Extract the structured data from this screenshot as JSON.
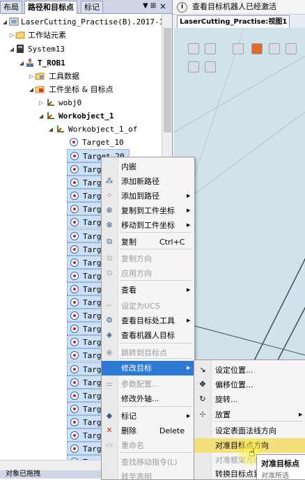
{
  "left_tabs": [
    "布局",
    "路径和目标点",
    "标记"
  ],
  "tab_pin": "▼ ⊞",
  "tab_close": "×",
  "bottom_tab": "对象已拖拽",
  "tree": {
    "station": "LaserCutting_Practise(B).2017-1-◦",
    "station_elements": "工作站元素",
    "system": "System13",
    "robot": "T_ROB1",
    "tool_data": "工具数据",
    "workobjects_targets": "工件坐标 & 目标点",
    "wobj0": "wobj0",
    "workobject1": "Workobject_1",
    "workobject1_of": "Workobject_1_of",
    "target10": "Target_10",
    "target20": "Target_20",
    "target_truncated": "Targ"
  },
  "info_bar": "查看目标机器人已经激活",
  "view_tab": "LaserCutting_Practise:视图1",
  "context_menu": {
    "items": [
      {
        "label": "内嵌",
        "icon": "",
        "disabled": false
      },
      {
        "label": "添加新路径",
        "icon": "new-path-icon",
        "disabled": false
      },
      {
        "label": "添加到路径",
        "icon": "add-to-path-icon",
        "disabled": false,
        "arrow": true
      },
      {
        "label": "复制到工件坐标",
        "icon": "copy-to-wobj-icon",
        "disabled": false,
        "arrow": true
      },
      {
        "label": "移动到工件坐标",
        "icon": "move-to-wobj-icon",
        "disabled": false,
        "arrow": true
      },
      {
        "label": "复制",
        "shortcut": "Ctrl+C",
        "icon": "copy-icon",
        "disabled": false
      },
      {
        "label": "复制方向",
        "icon": "copy-orientation-icon",
        "disabled": true
      },
      {
        "label": "应用方向",
        "icon": "apply-orientation-icon",
        "disabled": true
      },
      {
        "label": "查看",
        "icon": "",
        "disabled": false,
        "arrow": true
      },
      {
        "label": "设定为UCS",
        "icon": "ucs-icon",
        "disabled": true
      },
      {
        "label": "查看目标处工具",
        "icon": "view-tool-icon",
        "disabled": false,
        "arrow": true
      },
      {
        "label": "查看机器人目标",
        "icon": "view-robot-target-icon",
        "disabled": false
      },
      {
        "label": "跳转到目标点",
        "icon": "jump-to-target-icon",
        "disabled": true
      },
      {
        "label": "修改目标",
        "icon": "",
        "disabled": false,
        "arrow": true
      },
      {
        "label": "参数配置...",
        "icon": "config-icon",
        "disabled": true
      },
      {
        "label": "修改外轴...",
        "icon": "",
        "disabled": false
      },
      {
        "label": "标记",
        "icon": "tag-icon",
        "disabled": false,
        "arrow": true
      },
      {
        "label": "删除",
        "shortcut": "Delete",
        "icon": "delete-icon",
        "disabled": false
      },
      {
        "label": "重命名",
        "icon": "rename-icon",
        "disabled": true
      },
      {
        "label": "查找移动指令(L)",
        "icon": "",
        "disabled": true
      },
      {
        "label": "转至声明",
        "icon": "",
        "disabled": true
      }
    ]
  },
  "submenu": {
    "items": [
      {
        "label": "设定位置...",
        "icon": "set-position-icon",
        "disabled": false
      },
      {
        "label": "偏移位置...",
        "icon": "offset-position-icon",
        "disabled": false
      },
      {
        "label": "旋转...",
        "icon": "rotate-icon",
        "disabled": false
      },
      {
        "label": "放置",
        "icon": "place-icon",
        "disabled": false,
        "arrow": true
      },
      {
        "label": "设定表面法线方向",
        "icon": "",
        "disabled": false
      },
      {
        "label": "对准目标点方向",
        "icon": "",
        "disabled": false
      },
      {
        "label": "对准框架方向",
        "icon": "",
        "disabled": true
      },
      {
        "label": "转换目标点到",
        "icon": "",
        "disabled": false
      }
    ]
  },
  "tooltip": {
    "title": "对准目标点",
    "desc": "对准所选"
  }
}
